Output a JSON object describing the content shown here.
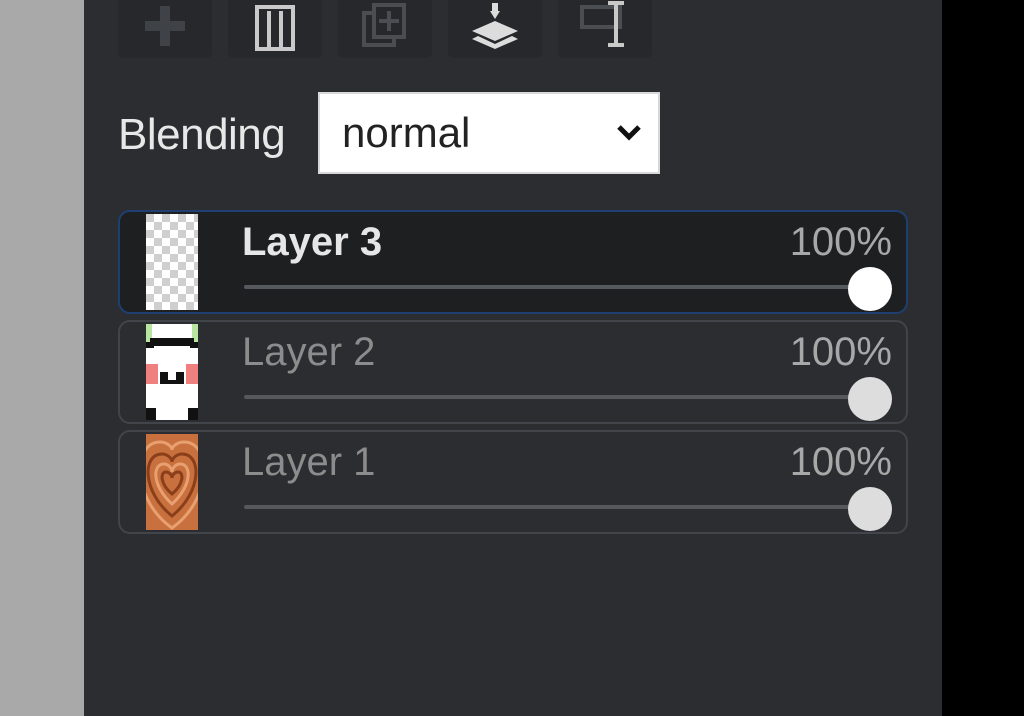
{
  "toolbar": {
    "buttons": [
      {
        "icon": "add-layer-icon"
      },
      {
        "icon": "trash-icon"
      },
      {
        "icon": "duplicate-icon"
      },
      {
        "icon": "merge-down-icon"
      },
      {
        "icon": "layer-properties-icon"
      }
    ]
  },
  "blending": {
    "label": "Blending",
    "value": "normal"
  },
  "layers": [
    {
      "name": "Layer 3",
      "opacity": "100%",
      "opacity_value": 1.0,
      "active": true,
      "thumb": "transparent-checker"
    },
    {
      "name": "Layer 2",
      "opacity": "100%",
      "opacity_value": 1.0,
      "active": false,
      "thumb": "panda-sprite"
    },
    {
      "name": "Layer 1",
      "opacity": "100%",
      "opacity_value": 1.0,
      "active": false,
      "thumb": "heart-pattern"
    }
  ],
  "colors": {
    "panel_bg": "#2b2d30",
    "active_layer_bg": "#1e1f21",
    "active_border": "#1f3f73",
    "heart_orange": "#c8703e"
  }
}
